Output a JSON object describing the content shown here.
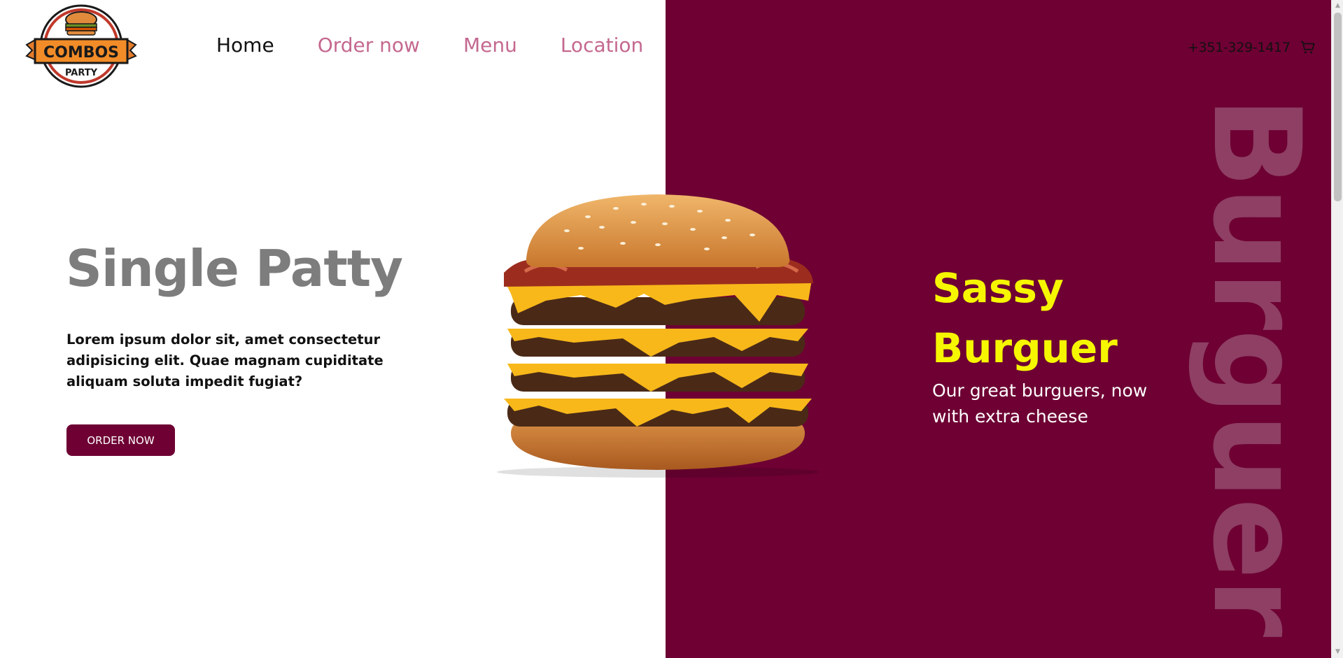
{
  "brand": {
    "logo_top": "COMBOS",
    "logo_bottom": "PARTY"
  },
  "nav": {
    "items": [
      {
        "label": "Home",
        "active": true
      },
      {
        "label": "Order now",
        "active": false
      },
      {
        "label": "Menu",
        "active": false
      },
      {
        "label": "Location",
        "active": false
      }
    ]
  },
  "header": {
    "phone": "+351-329-1417",
    "cart_icon": "cart-icon"
  },
  "hero": {
    "title": "Single Patty",
    "description": "Lorem ipsum dolor sit, amet consectetur adipisicing elit. Quae magnam cupiditate aliquam soluta impedit fugiat?",
    "button_label": "ORDER NOW"
  },
  "promo": {
    "title_line1": "Sassy",
    "title_line2": "Burguer",
    "subtitle": "Our great burguers, now with extra cheese",
    "vertical_word": "Burguer"
  },
  "colors": {
    "accent": "#6e0033",
    "nav_link": "#c4688f",
    "promo_title": "#f6f600",
    "hero_title": "#7d7d7d"
  }
}
